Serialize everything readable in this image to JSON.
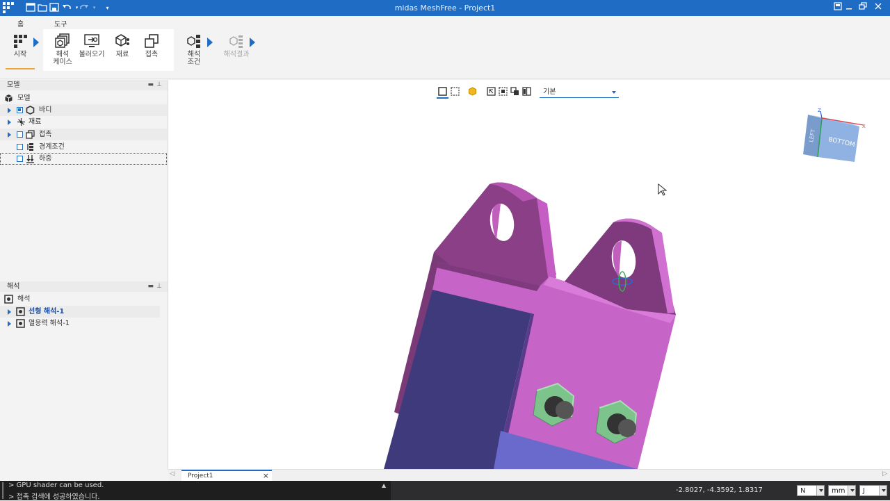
{
  "window": {
    "title": "midas MeshFree - Project1",
    "accent": "#1e6cc4"
  },
  "ribbon": {
    "tabs": [
      {
        "label": "홈",
        "active": true
      },
      {
        "label": "도구",
        "active": false
      }
    ],
    "start": {
      "label": "시작"
    },
    "buttons": [
      {
        "label": "해석\n케이스",
        "icon": "analysis-case-icon"
      },
      {
        "label": "불러오기",
        "icon": "import-icon"
      },
      {
        "label": "재료",
        "icon": "material-icon"
      },
      {
        "label": "접촉",
        "icon": "contact-icon"
      }
    ],
    "analysis_condition": {
      "label": "해석\n조건"
    },
    "analysis_result": {
      "label": "해석결과",
      "disabled": true
    }
  },
  "model_panel": {
    "title": "모델",
    "root": "모델",
    "items": [
      {
        "label": "바디",
        "checked": true,
        "expandable": true
      },
      {
        "label": "재료",
        "checked": null,
        "expandable": true
      },
      {
        "label": "접촉",
        "checked": false,
        "expandable": true
      },
      {
        "label": "경계조건",
        "checked": false,
        "expandable": false
      },
      {
        "label": "하중",
        "checked": false,
        "expandable": false,
        "selected": true
      }
    ]
  },
  "analysis_panel": {
    "title": "해석",
    "root": "해석",
    "items": [
      {
        "label": "선형 해석-1",
        "active": true
      },
      {
        "label": "열응력 해석-1",
        "active": false
      }
    ]
  },
  "viewport": {
    "view_mode": "기본",
    "view_cube": {
      "face_front": "BOTTOM",
      "face_side": "LEFT",
      "axis_x": "X",
      "axis_z": "Z"
    },
    "model_colors": {
      "dark": "#7a3a78",
      "light": "#c860c8",
      "blue": "#3d3a7a",
      "nut": "#7cc48c"
    }
  },
  "doc_tabs": [
    {
      "label": "Project1",
      "active": true
    }
  ],
  "status": {
    "output": [
      "> GPU shader can be used.",
      "> 접촉 검색에 성공하였습니다."
    ],
    "coordinates": "-2.8027, -4.3592, 1.8317",
    "unit_force": "N",
    "unit_length": "mm",
    "unit_energy": "J"
  }
}
